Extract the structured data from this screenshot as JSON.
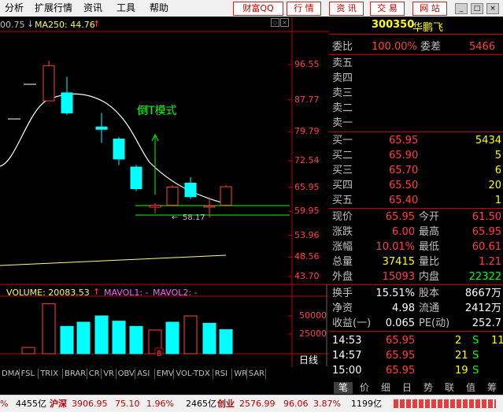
{
  "menu": [
    "分析",
    "扩展行情",
    "资讯",
    "工具",
    "帮助"
  ],
  "toolbar": [
    "财富QQ",
    "行 情",
    "资 讯",
    "交 易",
    "网 站"
  ],
  "chart": {
    "ma_header_left": "00.75",
    "ma_label": "MA250: 44.76",
    "price_axis": [
      "96.55",
      "87.77",
      "79.79",
      "72.54",
      "65.95",
      "59.95",
      "53.96",
      "48.56",
      "43.70"
    ],
    "annotation": "倒T模式",
    "low_label": "58.17",
    "volume_label": "VOLUME: 20083.53",
    "mavol1": "MAVOL1: -",
    "mavol2": "MAVOL2: -",
    "vol_axis": [
      "50000",
      "25000"
    ],
    "date_marker": "8",
    "daily": "日线"
  },
  "candles": [
    {
      "o": 87.5,
      "c": 96.3,
      "h": 97.5,
      "l": 87.5
    },
    {
      "o": 89.5,
      "c": 84.5,
      "h": 93.5,
      "l": 84.0
    },
    {
      "o": 81.0,
      "c": 80.4,
      "h": 84.5,
      "l": 77.0
    },
    {
      "o": 78.0,
      "c": 73.0,
      "h": 78.5,
      "l": 71.5
    },
    {
      "o": 71.0,
      "c": 65.6,
      "h": 71.5,
      "l": 65.0
    },
    {
      "o": 61.0,
      "c": 61.5,
      "h": 62.0,
      "l": 59.5
    },
    {
      "o": 61.5,
      "c": 66.0,
      "h": 66.5,
      "l": 61.5
    },
    {
      "o": 67.0,
      "c": 63.6,
      "h": 68.5,
      "l": 63.0
    },
    {
      "o": 61.0,
      "c": 61.3,
      "h": 63.5,
      "l": 58.4
    },
    {
      "o": 61.5,
      "c": 66.1,
      "h": 66.5,
      "l": 61.5
    }
  ],
  "volumes": [
    12,
    95,
    52,
    60,
    72,
    62,
    52,
    45,
    60,
    72,
    58,
    46
  ],
  "indicator_tabs": [
    "DMA",
    "FSL",
    "TRIX",
    "BRAR",
    "CR",
    "VR",
    "OBV",
    "ASI",
    "EMV",
    "VOL-TDX",
    "RSI",
    "WR",
    "SAR"
  ],
  "quote": {
    "code": "300350",
    "name": "华鹏飞",
    "weibi_label": "委比",
    "weibi_value": "100.00%",
    "weicha_label": "委差",
    "weicha_value": "5466",
    "asks": [
      {
        "label": "卖五",
        "price": "",
        "vol": ""
      },
      {
        "label": "卖四",
        "price": "",
        "vol": ""
      },
      {
        "label": "卖三",
        "price": "",
        "vol": ""
      },
      {
        "label": "卖二",
        "price": "",
        "vol": ""
      },
      {
        "label": "卖一",
        "price": "",
        "vol": ""
      }
    ],
    "bids": [
      {
        "label": "买一",
        "price": "65.95",
        "vol": "5434"
      },
      {
        "label": "买二",
        "price": "65.90",
        "vol": "5"
      },
      {
        "label": "买三",
        "price": "65.70",
        "vol": "6"
      },
      {
        "label": "买四",
        "price": "65.50",
        "vol": "20"
      },
      {
        "label": "买五",
        "price": "65.40",
        "vol": "1"
      }
    ],
    "stats": [
      {
        "l1": "现价",
        "v1": "65.95",
        "c1": "#ff4040",
        "l2": "今开",
        "v2": "61.50",
        "c2": "#ff4040"
      },
      {
        "l1": "涨跌",
        "v1": "6.00",
        "c1": "#ff4040",
        "l2": "最高",
        "v2": "65.95",
        "c2": "#ff4040"
      },
      {
        "l1": "涨幅",
        "v1": "10.01%",
        "c1": "#ff4040",
        "l2": "最低",
        "v2": "60.61",
        "c2": "#ff4040"
      },
      {
        "l1": "总量",
        "v1": "37415",
        "c1": "#ffff00",
        "l2": "量比",
        "v2": "1.21",
        "c2": "#ff4040"
      },
      {
        "l1": "外盘",
        "v1": "15093",
        "c1": "#ff4040",
        "l2": "内盘",
        "v2": "22322",
        "c2": "#00ff00"
      }
    ],
    "fund": [
      {
        "l1": "换手",
        "v1": "15.51%",
        "l2": "股本",
        "v2": "8667万"
      },
      {
        "l1": "净资",
        "v1": "4.98",
        "l2": "流通",
        "v2": "2412万"
      },
      {
        "l1": "收益(一)",
        "v1": "0.065",
        "l2": "PE(动)",
        "v2": "252.7"
      }
    ],
    "ticks": [
      {
        "time": "14:53",
        "price": "65.95",
        "vol": "2",
        "flag": "S"
      },
      {
        "time": "14:57",
        "price": "65.95",
        "vol": "21",
        "flag": "S"
      },
      {
        "time": "15:00",
        "price": "65.95",
        "vol": "19",
        "flag": "S"
      }
    ],
    "tick_extra": [
      "11",
      "",
      ""
    ]
  },
  "right_tabs": [
    "笔",
    "价",
    "细",
    "日",
    "势",
    "联",
    "值",
    "筹"
  ],
  "status": {
    "s1": "%",
    "s2": "4455亿",
    "hs_label": "沪深",
    "hs_value": "3906.95",
    "hs_change": "75.10",
    "hs_pct": "1.96%",
    "s3": "2465亿",
    "cy_label": "创业",
    "cy_value": "2576.99",
    "cy_change": "96.06",
    "cy_pct": "3.87%",
    "s4": "1199亿"
  }
}
